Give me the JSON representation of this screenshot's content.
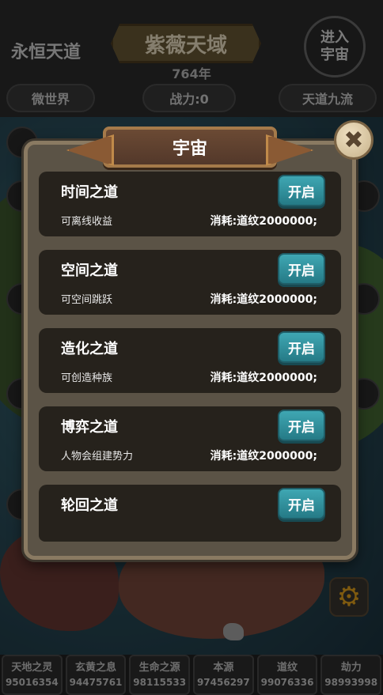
{
  "header": {
    "left_title": "永恒天道",
    "realm_title": "紫薇天域",
    "year": "764年",
    "enter_button": "进入宇宙",
    "tabs": [
      "微世界",
      "战力:0",
      "天道九流"
    ]
  },
  "modal": {
    "title": "宇宙",
    "close_icon": "close-icon",
    "items": [
      {
        "name": "时间之道",
        "desc": "可离线收益",
        "cost": "消耗:道纹2000000;",
        "button": "开启"
      },
      {
        "name": "空间之道",
        "desc": "可空间跳跃",
        "cost": "消耗:道纹2000000;",
        "button": "开启"
      },
      {
        "name": "造化之道",
        "desc": "可创造种族",
        "cost": "消耗:道纹2000000;",
        "button": "开启"
      },
      {
        "name": "博弈之道",
        "desc": "人物会组建势力",
        "cost": "消耗:道纹2000000;",
        "button": "开启"
      },
      {
        "name": "轮回之道",
        "desc": "",
        "cost": "",
        "button": "开启"
      }
    ]
  },
  "resources": [
    {
      "label": "天地之灵",
      "value": "95016354"
    },
    {
      "label": "玄黄之息",
      "value": "94475761"
    },
    {
      "label": "生命之源",
      "value": "98115533"
    },
    {
      "label": "本源",
      "value": "97456297"
    },
    {
      "label": "道纹",
      "value": "99076336"
    },
    {
      "label": "劫力",
      "value": "98993998"
    }
  ],
  "colors": {
    "accent_button": "#2f8f9c",
    "panel": "#26221c",
    "gear": "#e7a41c"
  },
  "icons": {
    "settings": "gear-icon"
  }
}
